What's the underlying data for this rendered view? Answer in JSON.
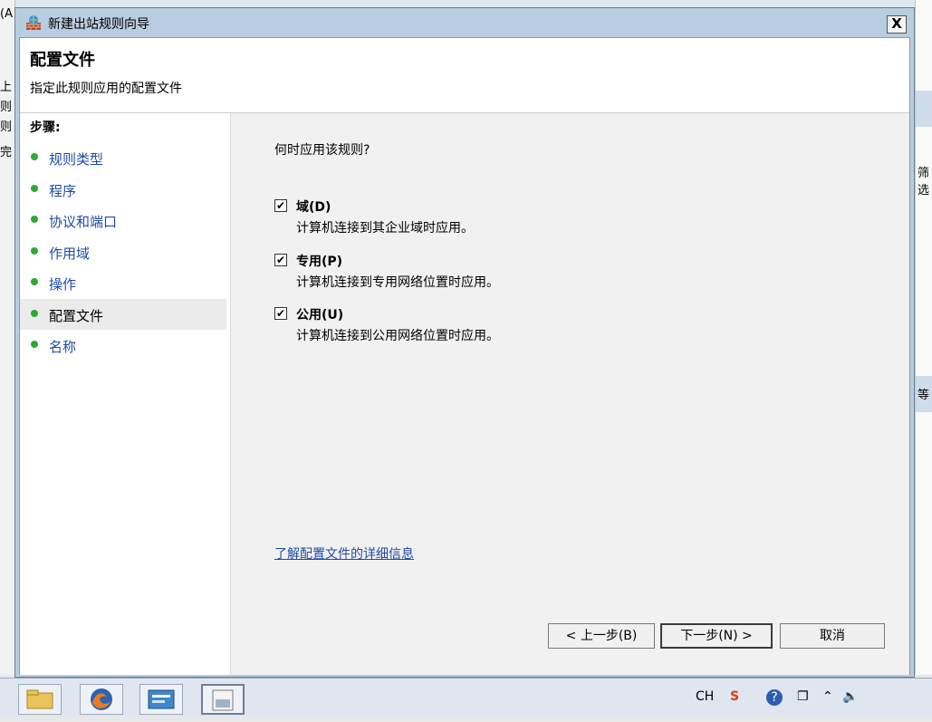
{
  "background": {
    "left_fragments": [
      "(A",
      "上",
      "则",
      "则",
      "完"
    ],
    "right_fragments": [
      "筛选",
      "等"
    ]
  },
  "dialog": {
    "title": "新建出站规则向导",
    "close_label": "X",
    "header_title": "配置文件",
    "header_subtitle": "指定此规则应用的配置文件",
    "steps_title": "步骤:",
    "steps": [
      {
        "label": "规则类型",
        "active": false
      },
      {
        "label": "程序",
        "active": false
      },
      {
        "label": "协议和端口",
        "active": false
      },
      {
        "label": "作用域",
        "active": false
      },
      {
        "label": "操作",
        "active": false
      },
      {
        "label": "配置文件",
        "active": true
      },
      {
        "label": "名称",
        "active": false
      }
    ],
    "question": "何时应用该规则?",
    "options": [
      {
        "title": "域(D)",
        "description": "计算机连接到其企业域时应用。",
        "checked": true
      },
      {
        "title": "专用(P)",
        "description": "计算机连接到专用网络位置时应用。",
        "checked": true
      },
      {
        "title": "公用(U)",
        "description": "计算机连接到公用网络位置时应用。",
        "checked": true
      }
    ],
    "learn_more_link": "了解配置文件的详细信息",
    "back_button": "< 上一步(B)",
    "next_button": "下一步(N) >",
    "cancel_button": "取消",
    "check_mark": "✔"
  },
  "taskbar": {
    "items": [
      "folder-icon",
      "firefox-icon",
      "server-manager-icon",
      "firewall-icon"
    ],
    "tray": {
      "lang": "CH",
      "sogou": "S",
      "help": "?"
    }
  }
}
